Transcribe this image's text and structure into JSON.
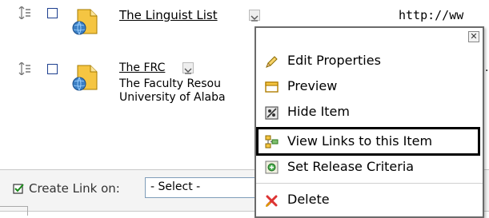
{
  "rows": [
    {
      "title": "The Linguist List",
      "url": "http://ww",
      "description": []
    },
    {
      "title": "The FRC",
      "url": "",
      "description": [
        "The Faculty Resou",
        "University of Alaba"
      ]
    }
  ],
  "create_link": {
    "label": "Create Link on:",
    "select_value": "- Select -"
  },
  "context_menu": {
    "close_glyph": "✕",
    "items": [
      {
        "label": "Edit Properties",
        "icon": "pencil-icon"
      },
      {
        "label": "Preview",
        "icon": "preview-window-icon"
      },
      {
        "label": "Hide Item",
        "icon": "hide-icon"
      },
      {
        "label": "View Links to this Item",
        "icon": "view-links-icon"
      },
      {
        "label": "Set Release Criteria",
        "icon": "release-criteria-icon"
      },
      {
        "label": "Delete",
        "icon": "delete-x-icon"
      }
    ]
  },
  "colors": {
    "folder_yellow": "#f5c542",
    "globe_blue": "#3b7fc4",
    "highlight_border": "#000000",
    "link": "#000000"
  },
  "dots": "."
}
